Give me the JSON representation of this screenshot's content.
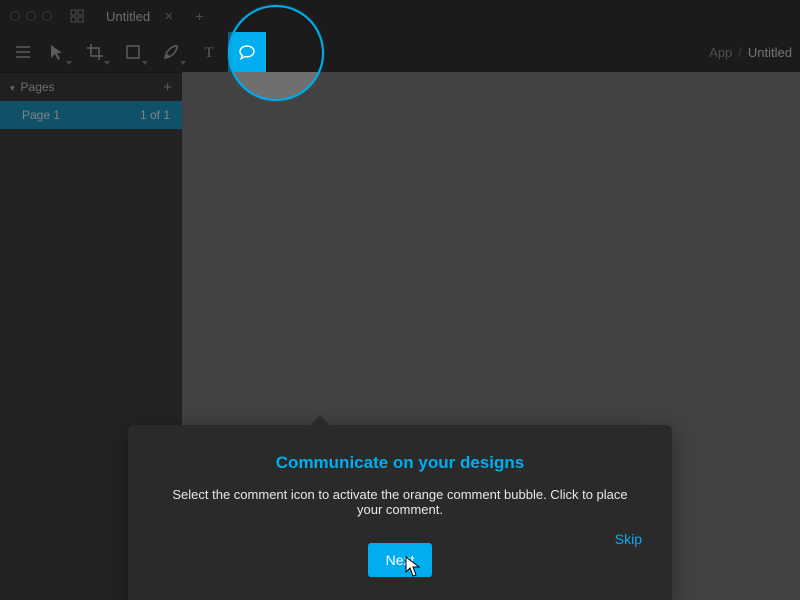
{
  "titlebar": {
    "tab_label": "Untitled"
  },
  "toolbar": {
    "breadcrumb_app": "App",
    "breadcrumb_doc": "Untitled"
  },
  "sidebar": {
    "pages_label": "Pages",
    "page1": {
      "name": "Page 1",
      "count": "1 of 1"
    }
  },
  "coach": {
    "title": "Communicate on your designs",
    "body": "Select the comment icon to activate the orange comment bubble. Click to place your comment.",
    "next_label": "Next",
    "skip_label": "Skip"
  },
  "colors": {
    "accent": "#00aeef"
  }
}
